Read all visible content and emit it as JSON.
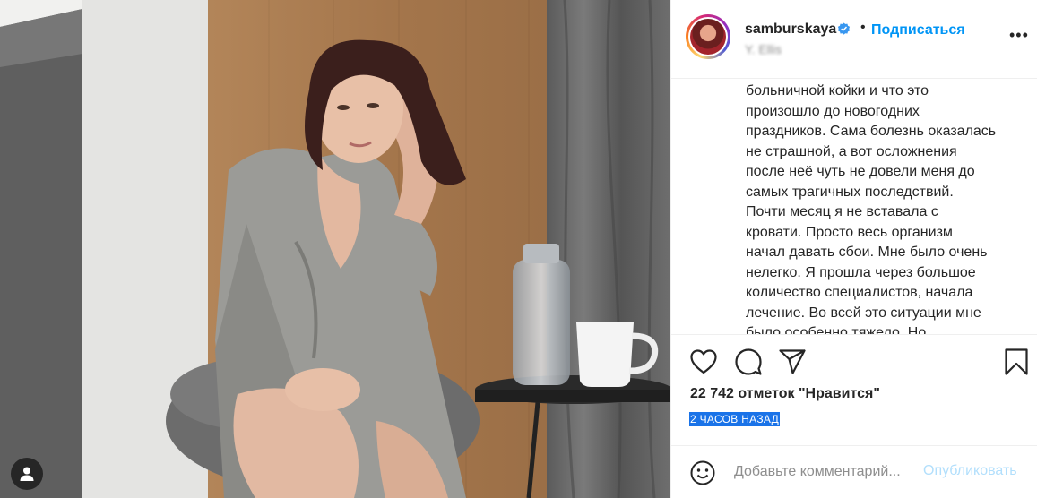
{
  "post": {
    "username": "samburskaya",
    "follow_label": "Подписаться",
    "dot": "•",
    "location": "Y. Ellis",
    "more": "•••",
    "caption_lines": [
      "больничной койки и что это",
      "произошло до новогодних",
      "праздников. Сама болезнь оказалась",
      "не страшной, а вот осложнения",
      "после неё чуть не довели меня до",
      "самых трагичных последствий.",
      "Почти месяц я не вставала с",
      "кровати. Просто весь организм",
      "начал давать сбои. Мне было очень",
      "нелегко. Я прошла через большое",
      "количество специалистов, начала",
      "лечение. Во всей это ситуации мне",
      "было особенно тяжело. Но"
    ],
    "likes": "22 742 отметок \"Нравится\"",
    "time": "2 часов назад",
    "comment_placeholder": "Добавьте комментарий...",
    "publish_label": "Опубликовать"
  },
  "icons": {
    "like": "heart-icon",
    "comment": "comment-icon",
    "share": "send-icon",
    "save": "bookmark-icon",
    "emoji": "smiley-icon",
    "verified": "verified-badge-icon",
    "profile": "user-icon"
  },
  "colors": {
    "accent": "#0095f6",
    "publish_disabled": "#b2dffc",
    "text": "#262626",
    "muted": "#8e8e8e",
    "selection": "#1a73e8"
  }
}
